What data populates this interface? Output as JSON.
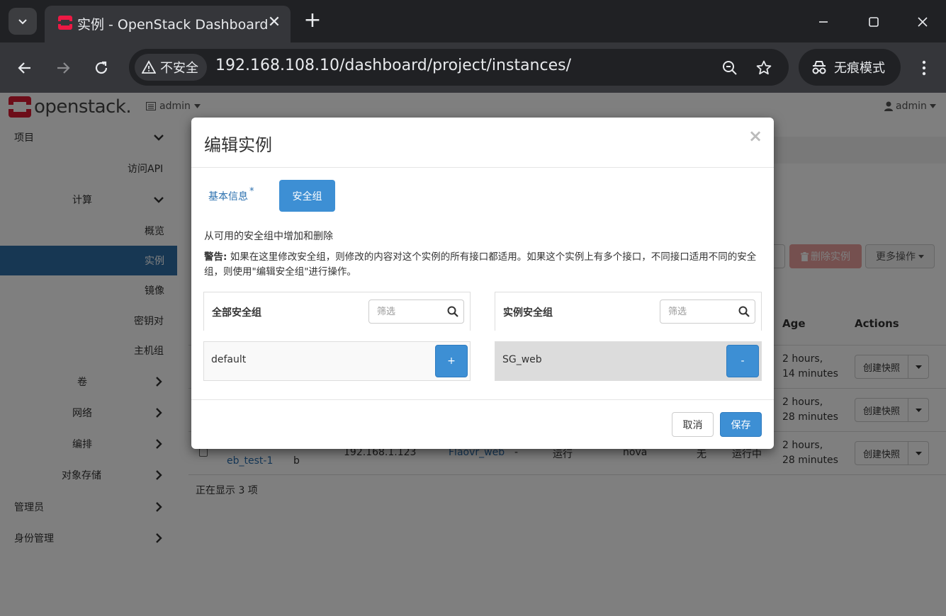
{
  "browser": {
    "tab_title": "实例 - OpenStack Dashboard",
    "security_label": "不安全",
    "url": "192.168.108.10/dashboard/project/instances/",
    "incognito_label": "无痕模式"
  },
  "header": {
    "logo_text": "openstack.",
    "project_label": "admin",
    "user_label": "admin"
  },
  "sidebar": {
    "items": [
      {
        "label": "项目"
      },
      {
        "label": "访问API"
      },
      {
        "label": "计算"
      },
      {
        "label": "概览"
      },
      {
        "label": "实例"
      },
      {
        "label": "镜像"
      },
      {
        "label": "密钥对"
      },
      {
        "label": "主机组"
      },
      {
        "label": "卷"
      },
      {
        "label": "网络"
      },
      {
        "label": "编排"
      },
      {
        "label": "对象存储"
      },
      {
        "label": "管理员"
      },
      {
        "label": "身份管理"
      }
    ]
  },
  "main": {
    "actions": {
      "delete_label": "删除实例",
      "more_label": "更多操作"
    },
    "columns": {
      "age": "Age",
      "actions": "Actions"
    },
    "rows": [
      {
        "age_line1": "2 hours,",
        "age_line2": "14 minutes",
        "action_label": "创建快照"
      },
      {
        "age_line1": "2 hours,",
        "age_line2": "28 minutes",
        "action_label": "创建快照"
      },
      {
        "name_partial": "eb_test-1",
        "image_partial": "b",
        "ip": "192.168.1.123",
        "flavor": "Flaovr_web",
        "keypair": "-",
        "status": "运行",
        "zone": "nova",
        "task": "无",
        "power": "运行中",
        "age_line1": "2 hours,",
        "age_line2": "28 minutes",
        "action_label": "创建快照"
      }
    ],
    "showing": "正在显示 3 项"
  },
  "modal": {
    "title": "编辑实例",
    "close": "×",
    "tabs": {
      "basic": "基本信息",
      "required_mark": "*",
      "security": "安全组"
    },
    "help": "从可用的安全组中增加和删除",
    "warning_label": "警告:",
    "warning_text": "如果在这里修改安全组，则修改的内容对这个实例的所有接口都适用。如果这个实例上有多个接口，不同接口适用不同的安全组，则使用\"编辑安全组\"进行操作。",
    "available": {
      "title": "全部安全组",
      "filter_placeholder": "筛选",
      "items": [
        {
          "name": "default",
          "action": "+"
        }
      ]
    },
    "selected": {
      "title": "实例安全组",
      "filter_placeholder": "筛选",
      "items": [
        {
          "name": "SG_web",
          "action": "-"
        }
      ]
    },
    "footer": {
      "cancel": "取消",
      "save": "保存"
    }
  }
}
